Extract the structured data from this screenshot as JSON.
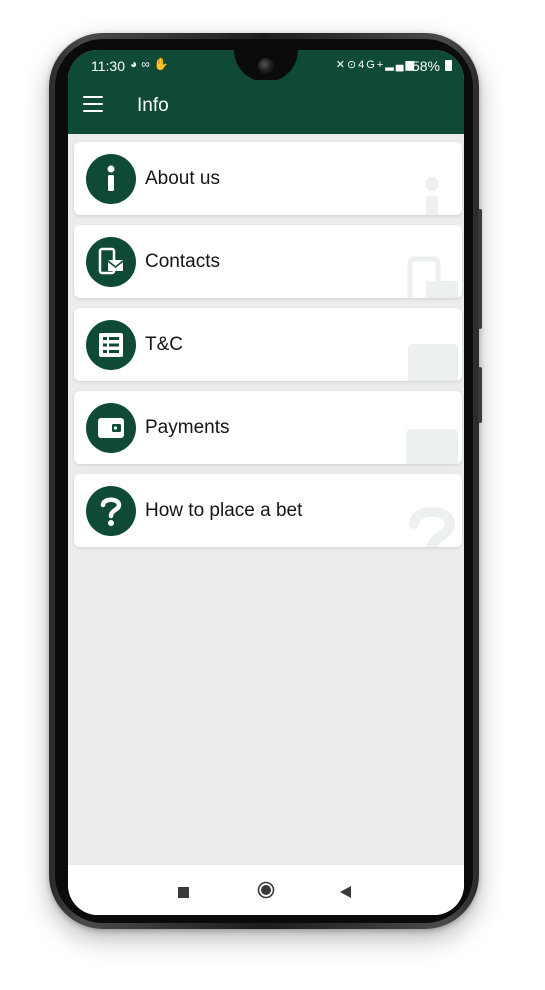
{
  "status_bar": {
    "time": "11:30",
    "left_icons": [
      "whatsapp-icon",
      "voicemail-icon",
      "hand-icon"
    ],
    "right_icons": [
      "mute-icon",
      "location-icon",
      "4g-icon",
      "signal-icon"
    ],
    "network": "4G+",
    "battery": "58%"
  },
  "appbar": {
    "title": "Info",
    "menu_icon": "menu-icon"
  },
  "items": [
    {
      "label": "About us",
      "icon": "info-icon"
    },
    {
      "label": "Contacts",
      "icon": "phone-mail-icon"
    },
    {
      "label": "T&C",
      "icon": "list-icon"
    },
    {
      "label": "Payments",
      "icon": "wallet-icon"
    },
    {
      "label": "How to place a bet",
      "icon": "question-icon"
    }
  ],
  "navigation": [
    "recent-apps-icon",
    "home-icon",
    "back-icon"
  ],
  "colors": {
    "primary": "#0e4a37",
    "background": "#ececec",
    "card": "#ffffff"
  }
}
